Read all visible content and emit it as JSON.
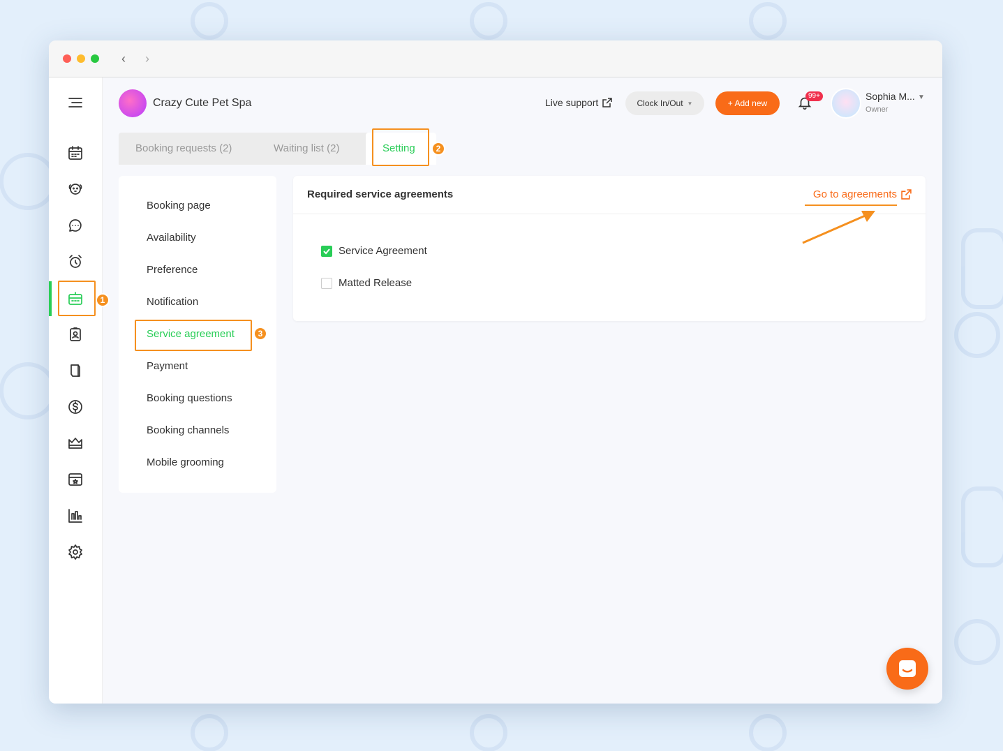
{
  "browser": {
    "back": "‹",
    "forward": "›"
  },
  "business": {
    "name": "Crazy Cute Pet Spa"
  },
  "header": {
    "live_support": "Live support",
    "clock_label": "Clock In/Out",
    "add_new_label": "+ Add new",
    "notification_count": "99+",
    "user_name": "Sophia M...",
    "user_role": "Owner"
  },
  "tabs": [
    {
      "label": "Booking requests (2)"
    },
    {
      "label": "Waiting list (2)"
    },
    {
      "label": "Setting"
    }
  ],
  "settings_menu": [
    {
      "label": "Booking page"
    },
    {
      "label": "Availability"
    },
    {
      "label": "Preference"
    },
    {
      "label": "Notification"
    },
    {
      "label": "Service agreement"
    },
    {
      "label": "Payment"
    },
    {
      "label": "Booking questions"
    },
    {
      "label": "Booking channels"
    },
    {
      "label": "Mobile grooming"
    }
  ],
  "panel": {
    "title": "Required service agreements",
    "goto_label": "Go to agreements",
    "agreements": [
      {
        "label": "Service Agreement",
        "checked": true
      },
      {
        "label": "Matted Release",
        "checked": false
      }
    ]
  },
  "sidebar_icons": [
    "menu-icon",
    "calendar-icon",
    "pet-icon",
    "chat-icon",
    "alarm-icon",
    "online-booking-icon",
    "client-card-icon",
    "retail-icon",
    "payment-icon",
    "membership-icon",
    "reviews-icon",
    "reports-icon",
    "settings-icon"
  ],
  "steps": [
    "1",
    "2",
    "3"
  ],
  "colors": {
    "accent_green": "#29cd57",
    "accent_orange": "#f96b18",
    "highlight": "#f5901f"
  }
}
